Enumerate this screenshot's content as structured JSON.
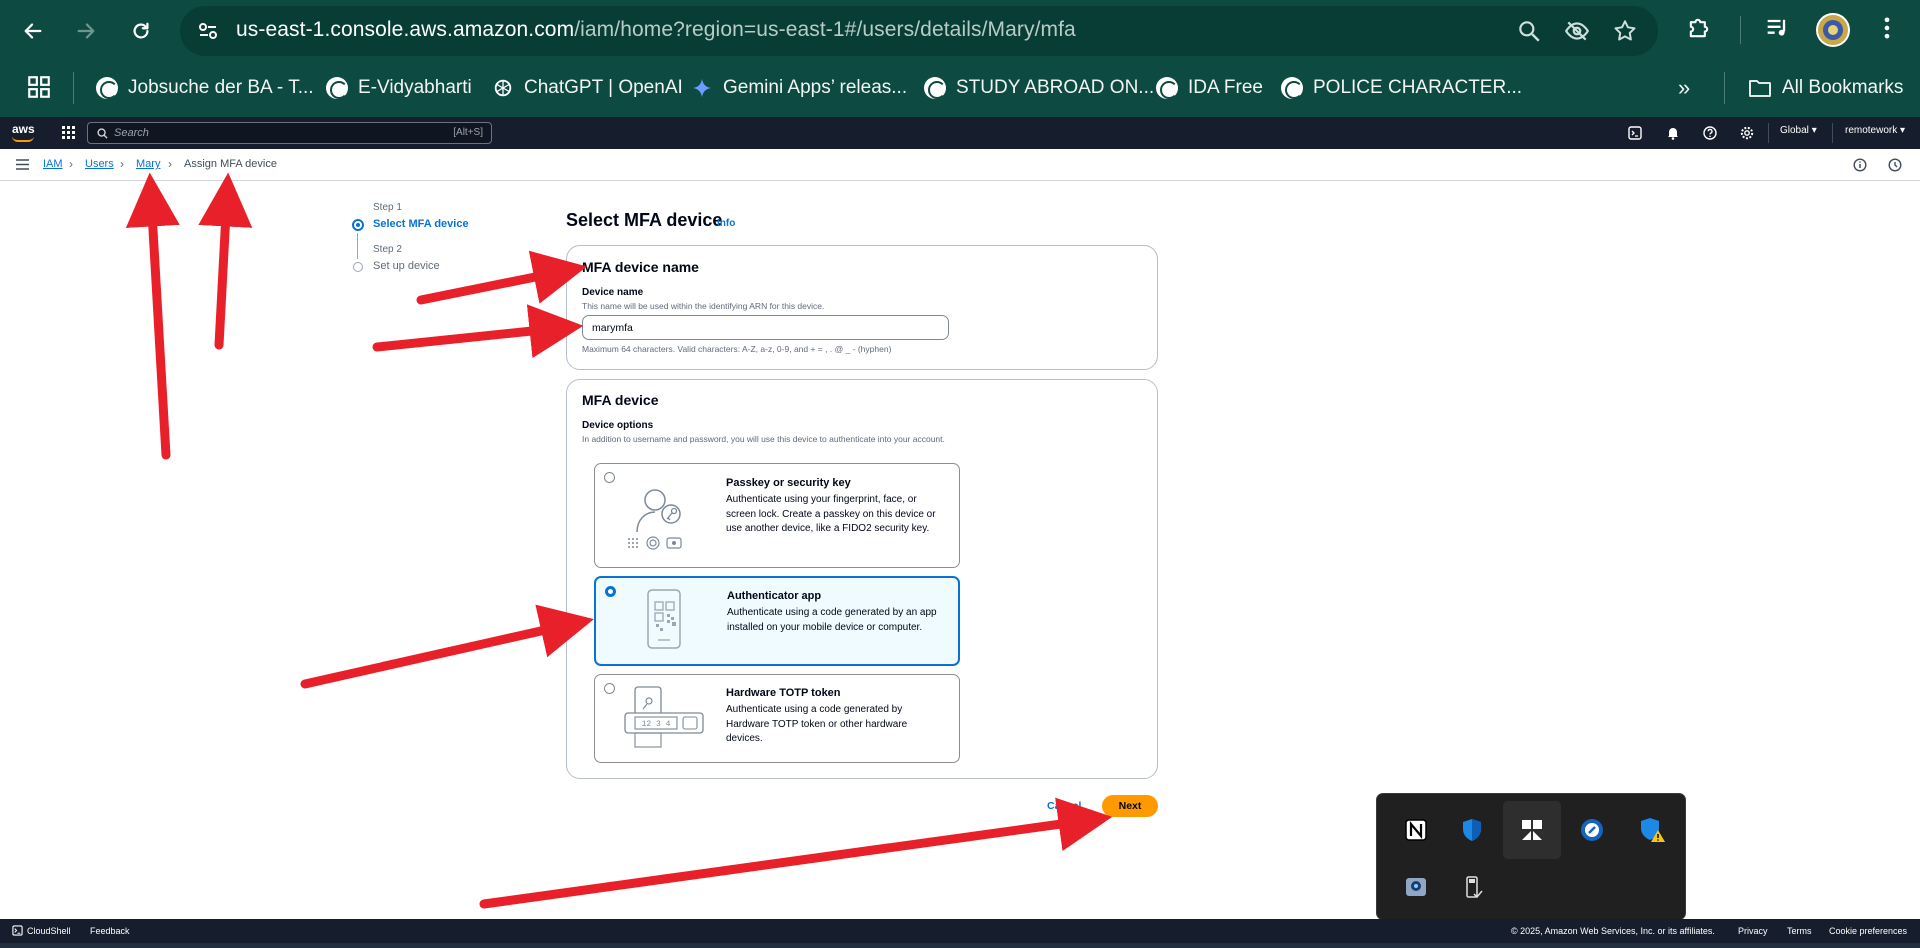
{
  "browser": {
    "url_host": "us-east-1.console.aws.amazon.com",
    "url_path": "/iam/home?region=us-east-1#/users/details/Mary/mfa",
    "bookmarks": [
      {
        "label": "Jobsuche der BA - T..."
      },
      {
        "label": "E-Vidyabharti"
      },
      {
        "label": "ChatGPT | OpenAI"
      },
      {
        "label": "Gemini Apps’ releas..."
      },
      {
        "label": "STUDY ABROAD ON..."
      },
      {
        "label": "IDA Free"
      },
      {
        "label": "POLICE CHARACTER..."
      }
    ],
    "all_bookmarks": "All Bookmarks",
    "overflow": "»"
  },
  "aws": {
    "logo": "aws",
    "search_placeholder": "Search",
    "search_shortcut": "[Alt+S]",
    "region": "Global",
    "account": "remotework"
  },
  "breadcrumb": {
    "items": [
      "IAM",
      "Users",
      "Mary"
    ],
    "current": "Assign MFA device"
  },
  "steps": [
    {
      "label": "Step 1",
      "name": "Select MFA device",
      "active": true
    },
    {
      "label": "Step 2",
      "name": "Set up device",
      "active": false
    }
  ],
  "page": {
    "title": "Select MFA device",
    "info": "Info"
  },
  "name_panel": {
    "heading": "MFA device name",
    "field_label": "Device name",
    "field_desc": "This name will be used within the identifying ARN for this device.",
    "value": "marymfa",
    "constraint": "Maximum 64 characters. Valid characters: A-Z, a-z, 0-9, and + = , . @ _ - (hyphen)"
  },
  "device_panel": {
    "heading": "MFA device",
    "options_label": "Device options",
    "options_desc": "In addition to username and password, you will use this device to authenticate into your account.",
    "options": [
      {
        "title": "Passkey or security key",
        "desc": "Authenticate using your fingerprint, face, or screen lock. Create a passkey on this device or use another device, like a FIDO2 security key.",
        "selected": false
      },
      {
        "title": "Authenticator app",
        "desc": "Authenticate using a code generated by an app installed on your mobile device or computer.",
        "selected": true
      },
      {
        "title": "Hardware TOTP token",
        "desc": "Authenticate using a code generated by Hardware TOTP token or other hardware devices.",
        "selected": false
      }
    ],
    "token_digits": "12 3 4"
  },
  "actions": {
    "cancel": "Cancel",
    "next": "Next"
  },
  "footer": {
    "cloudshell": "CloudShell",
    "feedback": "Feedback",
    "copyright": "© 2025, Amazon Web Services, Inc. or its affiliates.",
    "privacy": "Privacy",
    "terms": "Terms",
    "cookies": "Cookie preferences"
  },
  "colors": {
    "browser_bg": "#0d4a42",
    "aws_nav": "#161e2d",
    "link_blue": "#0972d3",
    "primary_orange": "#ff9900",
    "annotation_red": "#e8202a"
  }
}
